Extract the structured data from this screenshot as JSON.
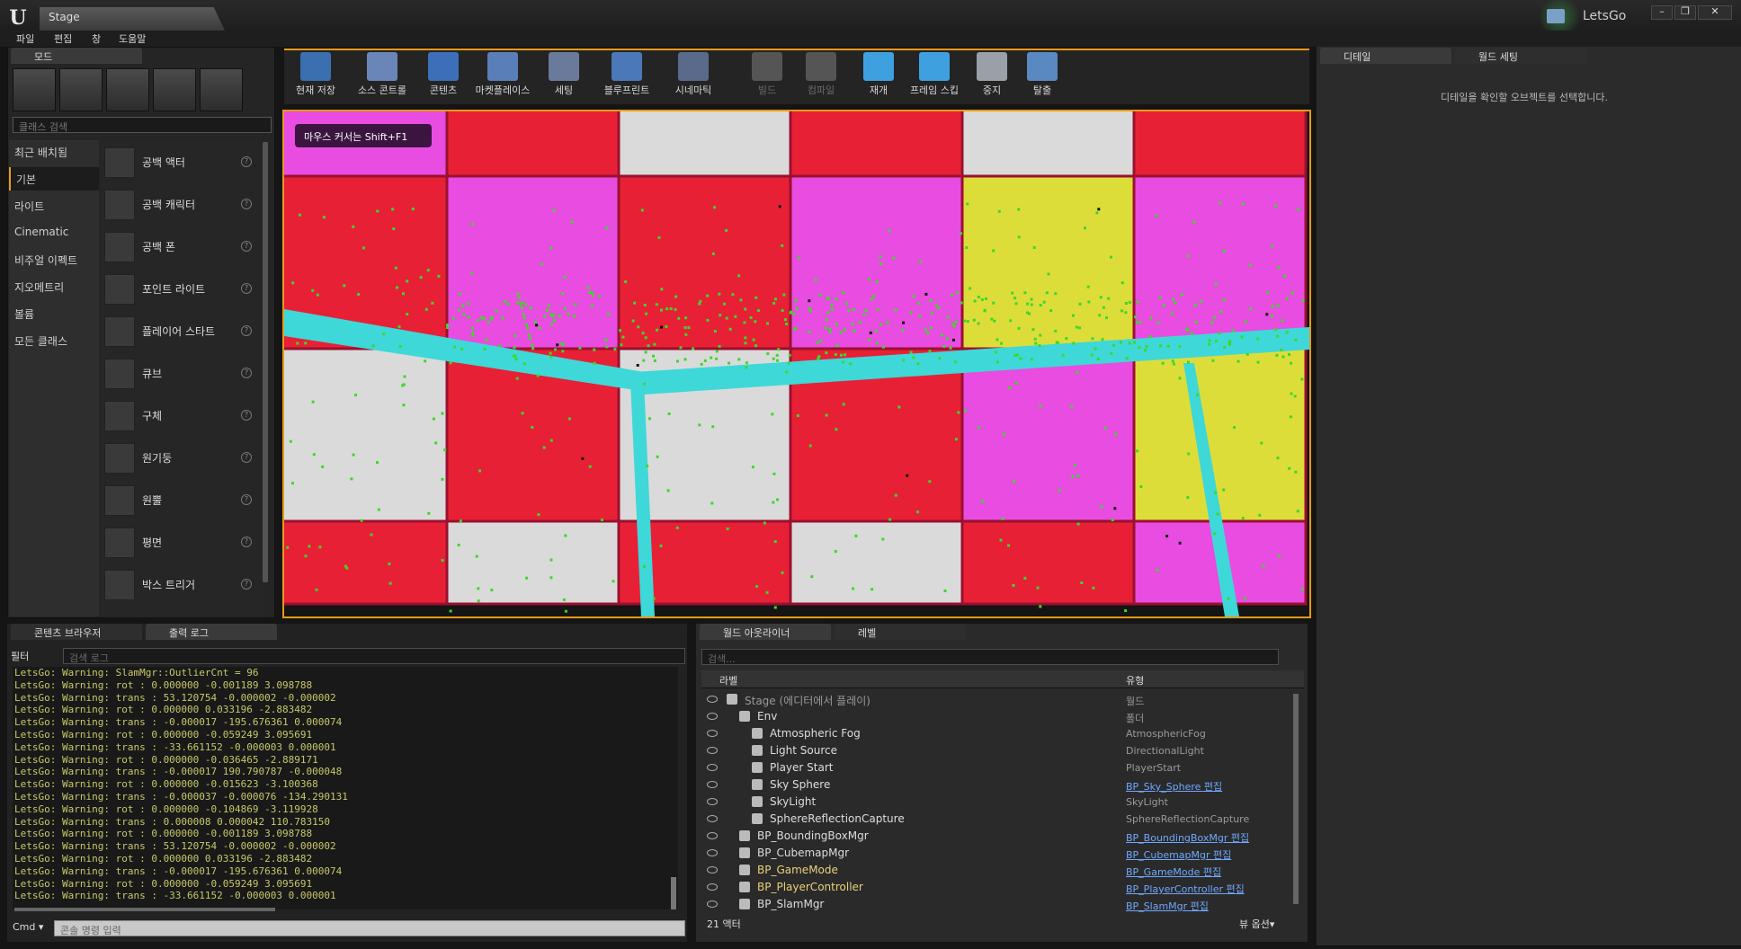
{
  "window": {
    "app_logo": "U",
    "doc_tab": "Stage",
    "project": "LetsGo",
    "min": "–",
    "max": "❐",
    "close": "✕"
  },
  "menu": [
    "파일",
    "편집",
    "창",
    "도움말"
  ],
  "modes": {
    "tab": "모드",
    "search_placeholder": "클래스 검색",
    "categories": [
      "최근 배치됨",
      "기본",
      "라이트",
      "Cinematic",
      "비주얼 이펙트",
      "지오메트리",
      "볼륨",
      "모든 클래스"
    ],
    "selected_category": "기본",
    "items": [
      "공백 액터",
      "공백 캐릭터",
      "공백 폰",
      "포인트 라이트",
      "플레이어 스타트",
      "큐브",
      "구체",
      "원기둥",
      "원뿔",
      "평면",
      "박스 트리거"
    ]
  },
  "toolbar": [
    {
      "label": "현재 저장",
      "icon": "save-icon",
      "enabled": true
    },
    {
      "label": "소스 콘트롤",
      "icon": "source-control-icon",
      "enabled": true
    },
    {
      "label": "콘텐츠",
      "icon": "content-icon",
      "enabled": true
    },
    {
      "label": "마켓플레이스",
      "icon": "marketplace-icon",
      "enabled": true
    },
    {
      "label": "세팅",
      "icon": "settings-icon",
      "enabled": true
    },
    {
      "label": "블루프린트",
      "icon": "blueprint-icon",
      "enabled": true
    },
    {
      "label": "시네마틱",
      "icon": "cinematic-icon",
      "enabled": true
    },
    {
      "label": "빌드",
      "icon": "build-icon",
      "enabled": false
    },
    {
      "label": "컴파일",
      "icon": "compile-icon",
      "enabled": false
    },
    {
      "label": "재개",
      "icon": "resume-icon",
      "enabled": true
    },
    {
      "label": "프레임 스킵",
      "icon": "frame-skip-icon",
      "enabled": true
    },
    {
      "label": "중지",
      "icon": "stop-icon",
      "enabled": true
    },
    {
      "label": "탈출",
      "icon": "eject-icon",
      "enabled": true
    }
  ],
  "viewport": {
    "hint": "마우스 커서는 Shift+F1",
    "colors": {
      "red": "#e82035",
      "pink": "#e84ce0",
      "white": "#dadada",
      "yellow": "#dddd3a",
      "cyan": "#3ed8d8",
      "points": "#3cd82a"
    }
  },
  "details": {
    "tab1": "디테일",
    "tab2": "월드 세팅",
    "message": "디테일을 확인할 오브젝트를 선택합니다."
  },
  "log": {
    "tab1": "콘텐츠 브라우저",
    "tab2": "출력 로그",
    "filter": "필터",
    "search_placeholder": "검색 로그",
    "lines": [
      "LetsGo: Warning: SlamMgr::OutlierCnt = 96",
      "LetsGo: Warning: rot : 0.000000 -0.001189 3.098788",
      "LetsGo: Warning: trans : 53.120754 -0.000002 -0.000002",
      "LetsGo: Warning: rot : 0.000000 0.033196 -2.883482",
      "LetsGo: Warning: trans : -0.000017 -195.676361 0.000074",
      "LetsGo: Warning: rot : 0.000000 -0.059249 3.095691",
      "LetsGo: Warning: trans : -33.661152 -0.000003 0.000001",
      "LetsGo: Warning: rot : 0.000000 -0.036465 -2.889171",
      "LetsGo: Warning: trans : -0.000017 190.790787 -0.000048",
      "LetsGo: Warning: rot : 0.000000 -0.015623 -3.100368",
      "LetsGo: Warning: trans : -0.000037 -0.000076 -134.290131",
      "LetsGo: Warning: rot : 0.000000 -0.104869 -3.119928",
      "LetsGo: Warning: trans : 0.000008 0.000042 110.783150",
      "LetsGo: Warning: rot : 0.000000 -0.001189 3.098788",
      "LetsGo: Warning: trans : 53.120754 -0.000002 -0.000002",
      "LetsGo: Warning: rot : 0.000000 0.033196 -2.883482",
      "LetsGo: Warning: trans : -0.000017 -195.676361 0.000074",
      "LetsGo: Warning: rot : 0.000000 -0.059249 3.095691",
      "LetsGo: Warning: trans : -33.661152 -0.000003 0.000001"
    ],
    "cmd_label": "Cmd ▾",
    "cmd_placeholder": "콘솔 명령 입력"
  },
  "outliner": {
    "tab1": "월드 아웃라이너",
    "tab2": "레벨",
    "search_placeholder": "검색...",
    "col_label": "라벨",
    "col_type": "유형",
    "rows": [
      {
        "name": "Stage (에디터에서 플레이)",
        "type": "월드",
        "link": false,
        "indent": 0,
        "dim": true
      },
      {
        "name": "Env",
        "type": "폴더",
        "link": false,
        "indent": 1,
        "dim": false
      },
      {
        "name": "Atmospheric Fog",
        "type": "AtmosphericFog",
        "link": false,
        "indent": 2,
        "dim": false
      },
      {
        "name": "Light Source",
        "type": "DirectionalLight",
        "link": false,
        "indent": 2,
        "dim": false
      },
      {
        "name": "Player Start",
        "type": "PlayerStart",
        "link": false,
        "indent": 2,
        "dim": false
      },
      {
        "name": "Sky Sphere",
        "type": "BP_Sky_Sphere 편집",
        "link": true,
        "indent": 2,
        "dim": false
      },
      {
        "name": "SkyLight",
        "type": "SkyLight",
        "link": false,
        "indent": 2,
        "dim": false
      },
      {
        "name": "SphereReflectionCapture",
        "type": "SphereReflectionCapture",
        "link": false,
        "indent": 2,
        "dim": false
      },
      {
        "name": "BP_BoundingBoxMgr",
        "type": "BP_BoundingBoxMgr 편집",
        "link": true,
        "indent": 1,
        "dim": false
      },
      {
        "name": "BP_CubemapMgr",
        "type": "BP_CubemapMgr 편집",
        "link": true,
        "indent": 1,
        "dim": false
      },
      {
        "name": "BP_GameMode",
        "type": "BP_GameMode 편집",
        "link": true,
        "indent": 1,
        "dim": false,
        "highlight": true
      },
      {
        "name": "BP_PlayerController",
        "type": "BP_PlayerController 편집",
        "link": true,
        "indent": 1,
        "dim": false,
        "highlight": true
      },
      {
        "name": "BP_SlamMgr",
        "type": "BP_SlamMgr 편집",
        "link": true,
        "indent": 1,
        "dim": false
      }
    ],
    "count": "21 액터",
    "view_options": "뷰 옵션▾"
  }
}
